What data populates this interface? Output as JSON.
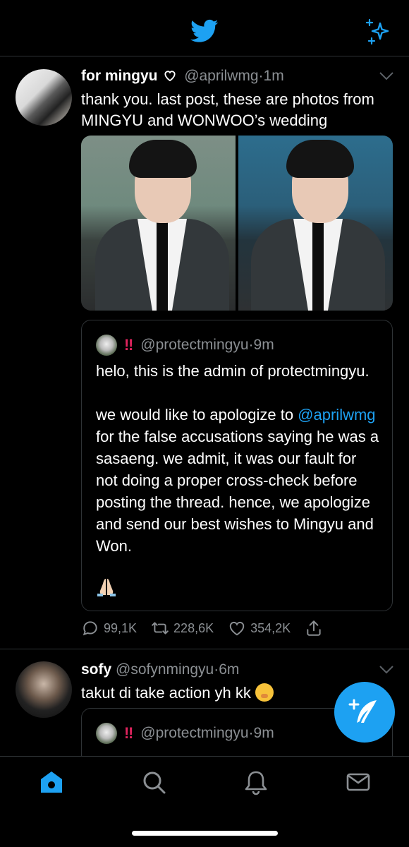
{
  "header": {
    "logo_icon": "twitter-bird-icon",
    "sparkle_icon": "sparkle-icon",
    "accent": "#1da1f2"
  },
  "tweet1": {
    "name": "for mingyu",
    "handle": "@aprilwmg",
    "time": "1m",
    "text": "thank you. last post, these are photos from MINGYU and WONWOO’s wedding",
    "quote": {
      "handle": "@protectmingyu",
      "time": "9m",
      "badge": "‼",
      "para1": "helo, this is the admin of protectmingyu.",
      "mention": "@aprilwmg",
      "para2_rest": " for the false accusations saying he was a sasaeng. we admit, it was our fault for not doing a proper cross-check before posting the thread. hence, we apologize and send our best wishes to Mingyu and Won.",
      "para2_lead": "we would like to apologize to "
    },
    "stats": {
      "replies": "99,1K",
      "retweets": "228,6K",
      "likes": "354,2K"
    }
  },
  "tweet2": {
    "name": "sofy",
    "handle": "@sofynmingyu",
    "time": "6m",
    "text": "takut di take action yh kk",
    "quote": {
      "handle": "@protectmingyu",
      "time": "9m",
      "badge": "‼"
    }
  },
  "dot": "·",
  "tabs": [
    "home-icon",
    "search-icon",
    "notifications-icon",
    "messages-icon"
  ]
}
